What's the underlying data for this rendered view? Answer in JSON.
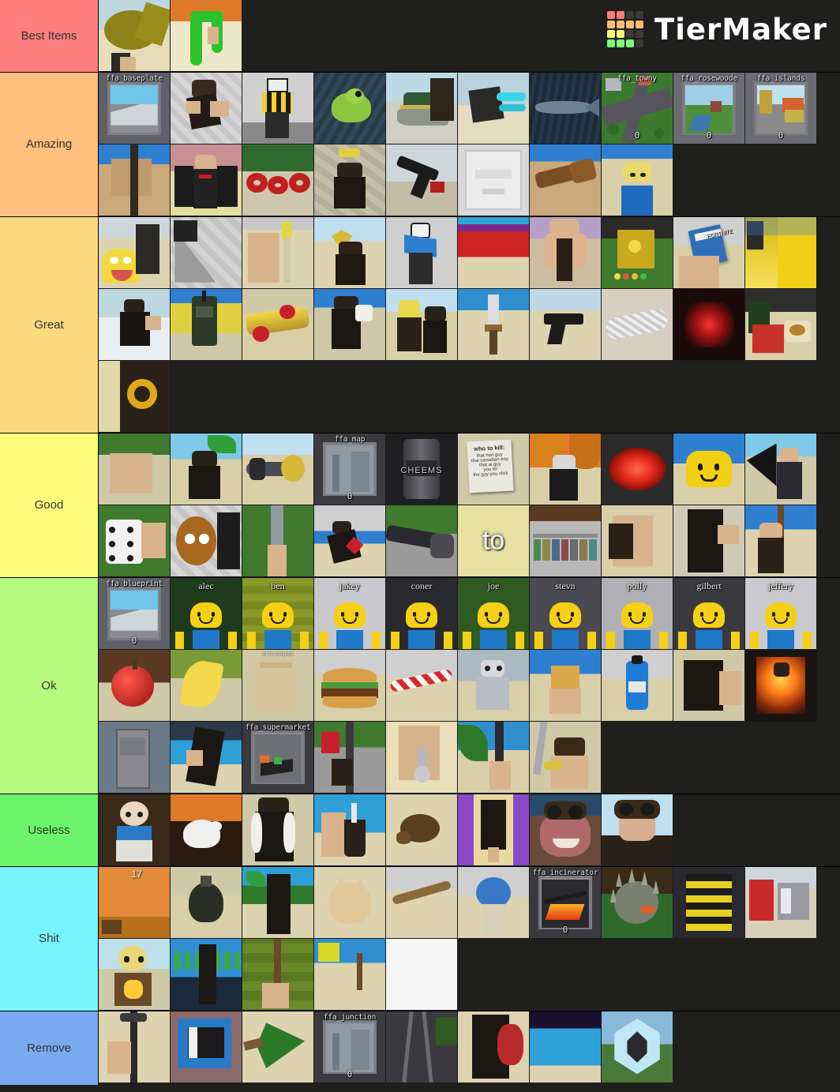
{
  "app": {
    "name": "TierMaker",
    "logo_colors": [
      "#fc7c7c",
      "#fc7c7c",
      "#3a3a38",
      "#3a3a38",
      "#fbbd73",
      "#fbbd73",
      "#fbbd73",
      "#fbbd73",
      "#fdfd7b",
      "#fdfd7b",
      "#3a3a38",
      "#3a3a38",
      "#7dfc7d",
      "#7dfc7d",
      "#7dfc7d",
      "#3a3a38"
    ],
    "background": "#1f1f1d"
  },
  "tiers": [
    {
      "label": "Best Items",
      "color": "#ff7f7f",
      "rows": [
        [
          {
            "name": "golden-blimp-item",
            "caption": "",
            "art": "gold-blob"
          },
          {
            "name": "green-noodle-item",
            "caption": "",
            "art": "green-tube"
          }
        ]
      ]
    },
    {
      "label": "Amazing",
      "color": "#ffbf7f",
      "rows": [
        [
          {
            "name": "ffa-baseplate-map",
            "caption": "ffa_baseplate",
            "art": "map-baseplate"
          },
          {
            "name": "black-suit-avatar",
            "caption": "",
            "art": "avatar-dark-brick"
          },
          {
            "name": "yellow-plaid-character",
            "caption": "",
            "art": "toon-plaid"
          },
          {
            "name": "green-frog-item",
            "caption": "",
            "art": "frog"
          },
          {
            "name": "crocodile-hat-item",
            "caption": "",
            "art": "croc"
          },
          {
            "name": "blue-energy-item",
            "caption": "",
            "art": "blue-energy"
          },
          {
            "name": "fish-item",
            "caption": "",
            "art": "fish"
          },
          {
            "name": "ffa-towny-map",
            "caption": "ffa_towny",
            "count": "0",
            "art": "map-towny"
          },
          {
            "name": "ffa-rosewoode-map",
            "caption": "ffa_rosewoode",
            "count": "0",
            "art": "map-rosewoode"
          },
          {
            "name": "ffa-islands-map",
            "caption": "ffa_islands",
            "count": "0",
            "art": "map-islands"
          }
        ],
        [
          {
            "name": "wood-post-item",
            "caption": "",
            "art": "wood-post"
          },
          {
            "name": "newspaper-avatar",
            "caption": "",
            "art": "newspaper"
          },
          {
            "name": "red-chain-item",
            "caption": "",
            "art": "red-chain"
          },
          {
            "name": "cobblestone-avatar",
            "caption": "",
            "art": "cobble-avatar"
          },
          {
            "name": "black-pistol-item",
            "caption": "",
            "art": "pistol"
          },
          {
            "name": "white-appliance-item",
            "caption": "",
            "art": "appliance"
          },
          {
            "name": "brass-spyglass-item",
            "caption": "",
            "art": "spyglass"
          },
          {
            "name": "sand-player-item",
            "caption": "",
            "art": "sand-player"
          }
        ]
      ]
    },
    {
      "label": "Great",
      "color": "#fcd97f",
      "rows": [
        [
          {
            "name": "wario-mask-item",
            "caption": "",
            "art": "wario"
          },
          {
            "name": "grey-ramp-item",
            "caption": "",
            "art": "grey-ramp"
          },
          {
            "name": "yellow-torch-item",
            "caption": "",
            "art": "yellow-torch"
          },
          {
            "name": "golden-shield-avatar",
            "caption": "",
            "art": "gold-shield"
          },
          {
            "name": "blue-scarf-toon",
            "caption": "",
            "art": "toon-scarf"
          },
          {
            "name": "red-carpet-scene",
            "caption": "",
            "art": "red-carpet"
          },
          {
            "name": "muscle-avatar",
            "caption": "",
            "art": "muscle"
          },
          {
            "name": "gold-coin-box-item",
            "caption": "",
            "art": "coin-box"
          },
          {
            "name": "fortnite-card-item",
            "caption": "FORTNITE",
            "art": "card"
          },
          {
            "name": "yellow-flame-item",
            "caption": "",
            "art": "flame-yellow"
          }
        ],
        [
          {
            "name": "snow-suit-avatar",
            "caption": "",
            "art": "snow-suit"
          },
          {
            "name": "green-radio-item",
            "caption": "",
            "art": "radio"
          },
          {
            "name": "gold-tube-item",
            "caption": "",
            "art": "gold-tube"
          },
          {
            "name": "milk-drink-avatar",
            "caption": "",
            "art": "milk"
          },
          {
            "name": "yellow-block-avatar",
            "caption": "",
            "art": "yellow-block"
          },
          {
            "name": "sand-sword-item",
            "caption": "",
            "art": "sand-sword"
          },
          {
            "name": "handgun-item",
            "caption": "",
            "art": "handgun"
          },
          {
            "name": "mesh-pipe-item",
            "caption": "",
            "art": "mesh-pipe"
          },
          {
            "name": "red-glow-item",
            "caption": "",
            "art": "red-glow"
          },
          {
            "name": "picnic-scene",
            "caption": "",
            "art": "picnic"
          }
        ],
        [
          {
            "name": "gear-machine-item",
            "caption": "",
            "art": "gear"
          }
        ]
      ]
    },
    {
      "label": "Good",
      "color": "#fdfd7b",
      "rows": [
        [
          {
            "name": "tan-brick-item",
            "caption": "",
            "art": "tan-brick"
          },
          {
            "name": "palm-tree-avatar",
            "caption": "",
            "art": "palm"
          },
          {
            "name": "gold-cannon-item",
            "caption": "",
            "art": "cannon"
          },
          {
            "name": "ffa-mapcard-item",
            "caption": "ffa_map",
            "count": "0",
            "art": "map-card"
          },
          {
            "name": "cheems-can-item",
            "caption": "CHEEMS",
            "art": "can"
          },
          {
            "name": "who-to-kill-note",
            "caption": "who to kill:",
            "art": "note"
          },
          {
            "name": "pineapple-avatar",
            "caption": "",
            "art": "pineapple"
          },
          {
            "name": "red-glow-disc-item",
            "caption": "",
            "art": "red-disc"
          },
          {
            "name": "smiley-head-item",
            "caption": "",
            "art": "smiley"
          },
          {
            "name": "black-wings-avatar",
            "caption": "",
            "art": "wings"
          }
        ],
        [
          {
            "name": "white-dice-item",
            "caption": "",
            "art": "dice"
          },
          {
            "name": "wooden-face-item",
            "caption": "",
            "art": "wood-face"
          },
          {
            "name": "grey-pole-item",
            "caption": "",
            "art": "grey-pole"
          },
          {
            "name": "running-avatar",
            "caption": "",
            "art": "running"
          },
          {
            "name": "long-gun-item",
            "caption": "",
            "art": "long-gun"
          },
          {
            "name": "to-sign-item",
            "caption": "to",
            "art": "to-sign"
          },
          {
            "name": "shop-shelves-scene",
            "caption": "",
            "art": "shelves"
          },
          {
            "name": "brown-crate-item",
            "caption": "",
            "art": "crate"
          },
          {
            "name": "dark-avatar-item",
            "caption": "",
            "art": "dark-avatar"
          },
          {
            "name": "staff-avatar-item",
            "caption": "",
            "art": "staff"
          }
        ]
      ]
    },
    {
      "label": "Ok",
      "color": "#b6fb7e",
      "rows": [
        [
          {
            "name": "ffa-blueprint-map",
            "caption": "ffa_blueprint",
            "count": "0",
            "art": "blueprint"
          },
          {
            "name": "alec-avatar",
            "caption": "alec",
            "art": "noob-green"
          },
          {
            "name": "ben-avatar",
            "caption": "ben",
            "art": "noob-brick"
          },
          {
            "name": "jakey-avatar",
            "caption": "jakey",
            "art": "noob-grey"
          },
          {
            "name": "coner-avatar",
            "caption": "coner",
            "art": "noob-dark"
          },
          {
            "name": "joe-avatar",
            "caption": "joe",
            "art": "noob-grass"
          },
          {
            "name": "stevn-avatar",
            "caption": "stevn",
            "art": "noob-slate"
          },
          {
            "name": "polly-avatar",
            "caption": "polly",
            "art": "noob-hall"
          },
          {
            "name": "gilbert-avatar",
            "caption": "gilbert",
            "art": "noob-wall"
          },
          {
            "name": "jeffery-avatar",
            "caption": "jeffery",
            "art": "noob-light"
          }
        ],
        [
          {
            "name": "red-apple-item",
            "caption": "",
            "art": "apple"
          },
          {
            "name": "banana-item",
            "caption": "",
            "art": "banana"
          },
          {
            "name": "paper-bag-item",
            "caption": "er is using by",
            "art": "paper-bag"
          },
          {
            "name": "burger-item",
            "caption": "",
            "art": "burger"
          },
          {
            "name": "candy-cane-item",
            "caption": "",
            "art": "candy"
          },
          {
            "name": "robot-avatar",
            "caption": "",
            "art": "robot"
          },
          {
            "name": "cat-block-item",
            "caption": "",
            "art": "cat-block"
          },
          {
            "name": "blue-bottle-item",
            "caption": "",
            "art": "bottle"
          },
          {
            "name": "black-box-item",
            "caption": "",
            "art": "black-box"
          },
          {
            "name": "fire-avatar-item",
            "caption": "",
            "art": "fire-avatar"
          }
        ],
        [
          {
            "name": "grey-door-item",
            "caption": "",
            "art": "door"
          },
          {
            "name": "ocean-avatar-item",
            "caption": "",
            "art": "ocean-avatar"
          },
          {
            "name": "ffa-supermarket-map",
            "caption": "ffa_supermarket",
            "art": "supermarket"
          },
          {
            "name": "street-pole-item",
            "caption": "",
            "art": "street-pole"
          },
          {
            "name": "metal-spoon-item",
            "caption": "",
            "art": "spoon"
          },
          {
            "name": "leaf-pole-item",
            "caption": "",
            "art": "leaf-pole"
          },
          {
            "name": "goggles-sword-avatar",
            "caption": "",
            "art": "goggles-sword"
          }
        ]
      ]
    },
    {
      "label": "Useless",
      "color": "#6cf56c",
      "rows": [
        [
          {
            "name": "baby-avatar",
            "caption": "",
            "art": "baby"
          },
          {
            "name": "white-bird-item",
            "caption": "",
            "art": "bird"
          },
          {
            "name": "fancy-suit-avatar",
            "caption": "",
            "art": "fancy-suit"
          },
          {
            "name": "drink-cup-item",
            "caption": "",
            "art": "cup"
          },
          {
            "name": "turtle-item",
            "caption": "",
            "art": "turtle"
          },
          {
            "name": "purple-room-avatar",
            "caption": "",
            "art": "purple-room"
          },
          {
            "name": "goggles-face-avatar",
            "caption": "",
            "art": "face-goggles"
          },
          {
            "name": "goggles-avatar",
            "caption": "",
            "art": "goggles"
          }
        ]
      ]
    },
    {
      "label": "Shit",
      "color": "#77f3fb",
      "rows": [
        [
          {
            "name": "number-17-item",
            "caption": "17",
            "art": "seventeen"
          },
          {
            "name": "black-grenade-item",
            "caption": "",
            "art": "grenade"
          },
          {
            "name": "palm-beach-avatar",
            "caption": "",
            "art": "palm-beach"
          },
          {
            "name": "fat-cat-item",
            "caption": "",
            "art": "fat-cat"
          },
          {
            "name": "wood-stick-item",
            "caption": "",
            "art": "stick"
          },
          {
            "name": "blue-orb-avatar",
            "caption": "",
            "art": "blue-orb"
          },
          {
            "name": "ffa-incinerator-map",
            "caption": "ffa_incinerator",
            "count": "0",
            "art": "incinerator"
          },
          {
            "name": "spiked-ball-item",
            "caption": "",
            "art": "spiked-ball"
          },
          {
            "name": "yellow-stripe-avatar",
            "caption": "",
            "art": "stripe-avatar"
          },
          {
            "name": "store-scene-item",
            "caption": "",
            "art": "store"
          }
        ],
        [
          {
            "name": "torch-avatar-item",
            "caption": "",
            "art": "torch-avatar"
          },
          {
            "name": "bottle-shelf-item",
            "caption": "",
            "art": "bottle-shelf"
          },
          {
            "name": "green-wall-item",
            "caption": "",
            "art": "green-wall"
          },
          {
            "name": "beach-scene-item",
            "caption": "",
            "art": "beach"
          },
          {
            "name": "white-blank-item",
            "caption": "",
            "art": "blank-white"
          }
        ]
      ]
    },
    {
      "label": "Remove",
      "color": "#79a9ee",
      "rows": [
        [
          {
            "name": "lamp-post-item",
            "caption": "",
            "art": "lamp"
          },
          {
            "name": "blue-box-item",
            "caption": "",
            "art": "blue-box"
          },
          {
            "name": "pine-tree-item",
            "caption": "",
            "art": "pine"
          },
          {
            "name": "ffa-junction-map",
            "caption": "ffa_junction",
            "count": "0",
            "art": "junction"
          },
          {
            "name": "ladder-scene-item",
            "caption": "",
            "art": "ladder"
          },
          {
            "name": "red-shield-avatar",
            "caption": "",
            "art": "red-shield"
          },
          {
            "name": "blue-water-item",
            "caption": "",
            "art": "water"
          },
          {
            "name": "hex-portal-item",
            "caption": "",
            "art": "hex-portal"
          }
        ]
      ]
    }
  ]
}
